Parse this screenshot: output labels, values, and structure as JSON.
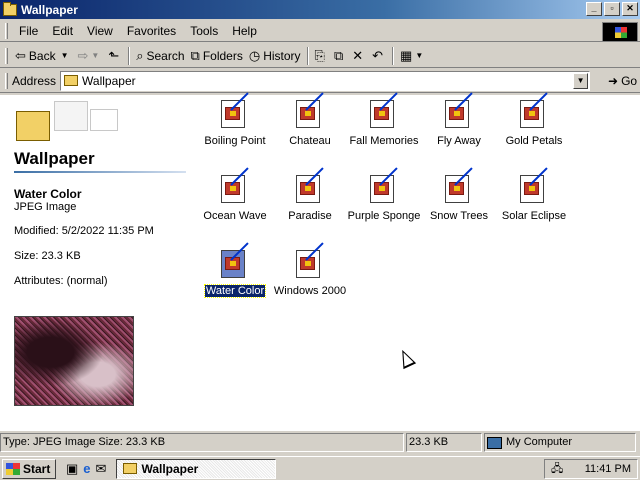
{
  "window": {
    "title": "Wallpaper"
  },
  "menu": [
    "File",
    "Edit",
    "View",
    "Favorites",
    "Tools",
    "Help"
  ],
  "toolbar": {
    "back": "Back",
    "search": "Search",
    "folders": "Folders",
    "history": "History"
  },
  "address": {
    "label": "Address",
    "value": "Wallpaper",
    "go": "Go"
  },
  "left_pane": {
    "folder_title": "Wallpaper",
    "selected_name": "Water Color",
    "selected_type": "JPEG Image",
    "modified": "Modified: 5/2/2022 11:35 PM",
    "size": "Size: 23.3 KB",
    "attributes": "Attributes: (normal)"
  },
  "files": [
    {
      "label": "Boiling Point"
    },
    {
      "label": "Chateau"
    },
    {
      "label": "Fall Memories"
    },
    {
      "label": "Fly Away"
    },
    {
      "label": "Gold Petals"
    },
    {
      "label": "Ocean Wave"
    },
    {
      "label": "Paradise"
    },
    {
      "label": "Purple Sponge"
    },
    {
      "label": "Snow Trees"
    },
    {
      "label": "Solar Eclipse"
    },
    {
      "label": "Water Color",
      "selected": true
    },
    {
      "label": "Windows 2000"
    }
  ],
  "statusbar": {
    "info": "Type: JPEG Image Size: 23.3 KB",
    "size": "23.3 KB",
    "zone": "My Computer"
  },
  "taskbar": {
    "start": "Start",
    "task": "Wallpaper",
    "clock": "11:41 PM"
  },
  "colors": {
    "titlebar": "#0a246a",
    "selection": "#0a246a",
    "chrome": "#d4d0c8",
    "desktop": "#008080"
  }
}
